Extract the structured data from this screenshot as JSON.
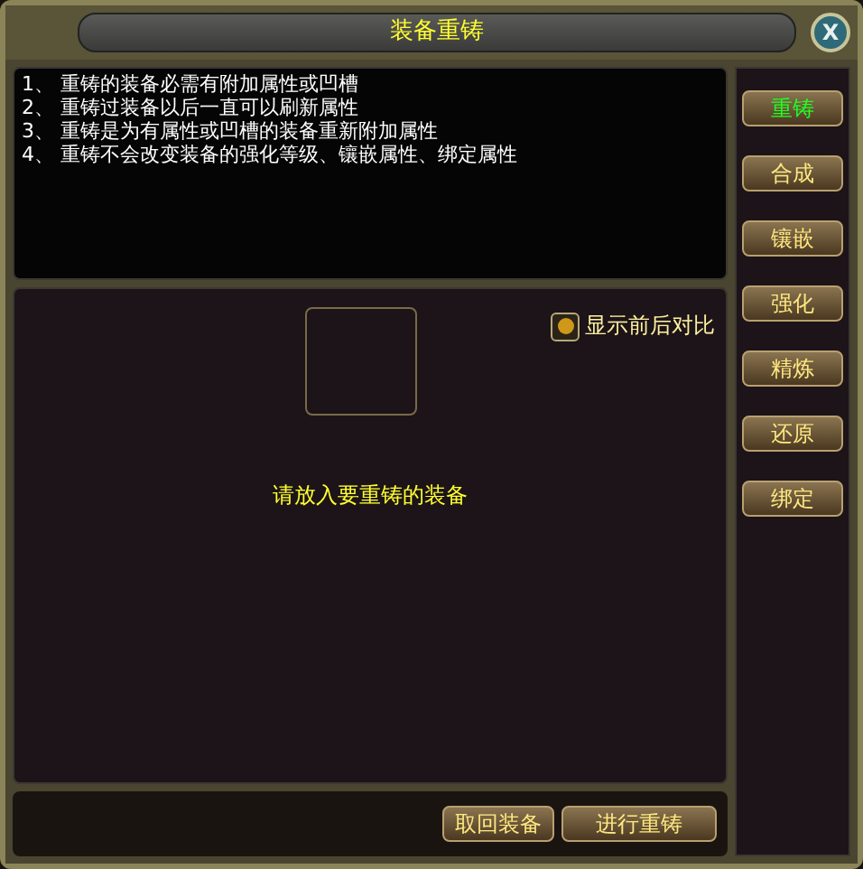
{
  "window": {
    "title": "装备重铸",
    "close": "X"
  },
  "rules": [
    "1、 重铸的装备必需有附加属性或凹槽",
    "2、 重铸过装备以后一直可以刷新属性",
    "3、 重铸是为有属性或凹槽的装备重新附加属性",
    "4、 重铸不会改变装备的强化等级、镶嵌属性、绑定属性"
  ],
  "compare_toggle": {
    "label": "显示前后对比",
    "checked": true
  },
  "hint": "请放入要重铸的装备",
  "buttons": [
    "取回装备",
    "进行重铸"
  ],
  "tabs": [
    {
      "label": "重铸",
      "selected": true
    },
    {
      "label": "合成",
      "selected": false
    },
    {
      "label": "镶嵌",
      "selected": false
    },
    {
      "label": "强化",
      "selected": false
    },
    {
      "label": "精炼",
      "selected": false
    },
    {
      "label": "还原",
      "selected": false
    },
    {
      "label": "绑定",
      "selected": false
    }
  ]
}
